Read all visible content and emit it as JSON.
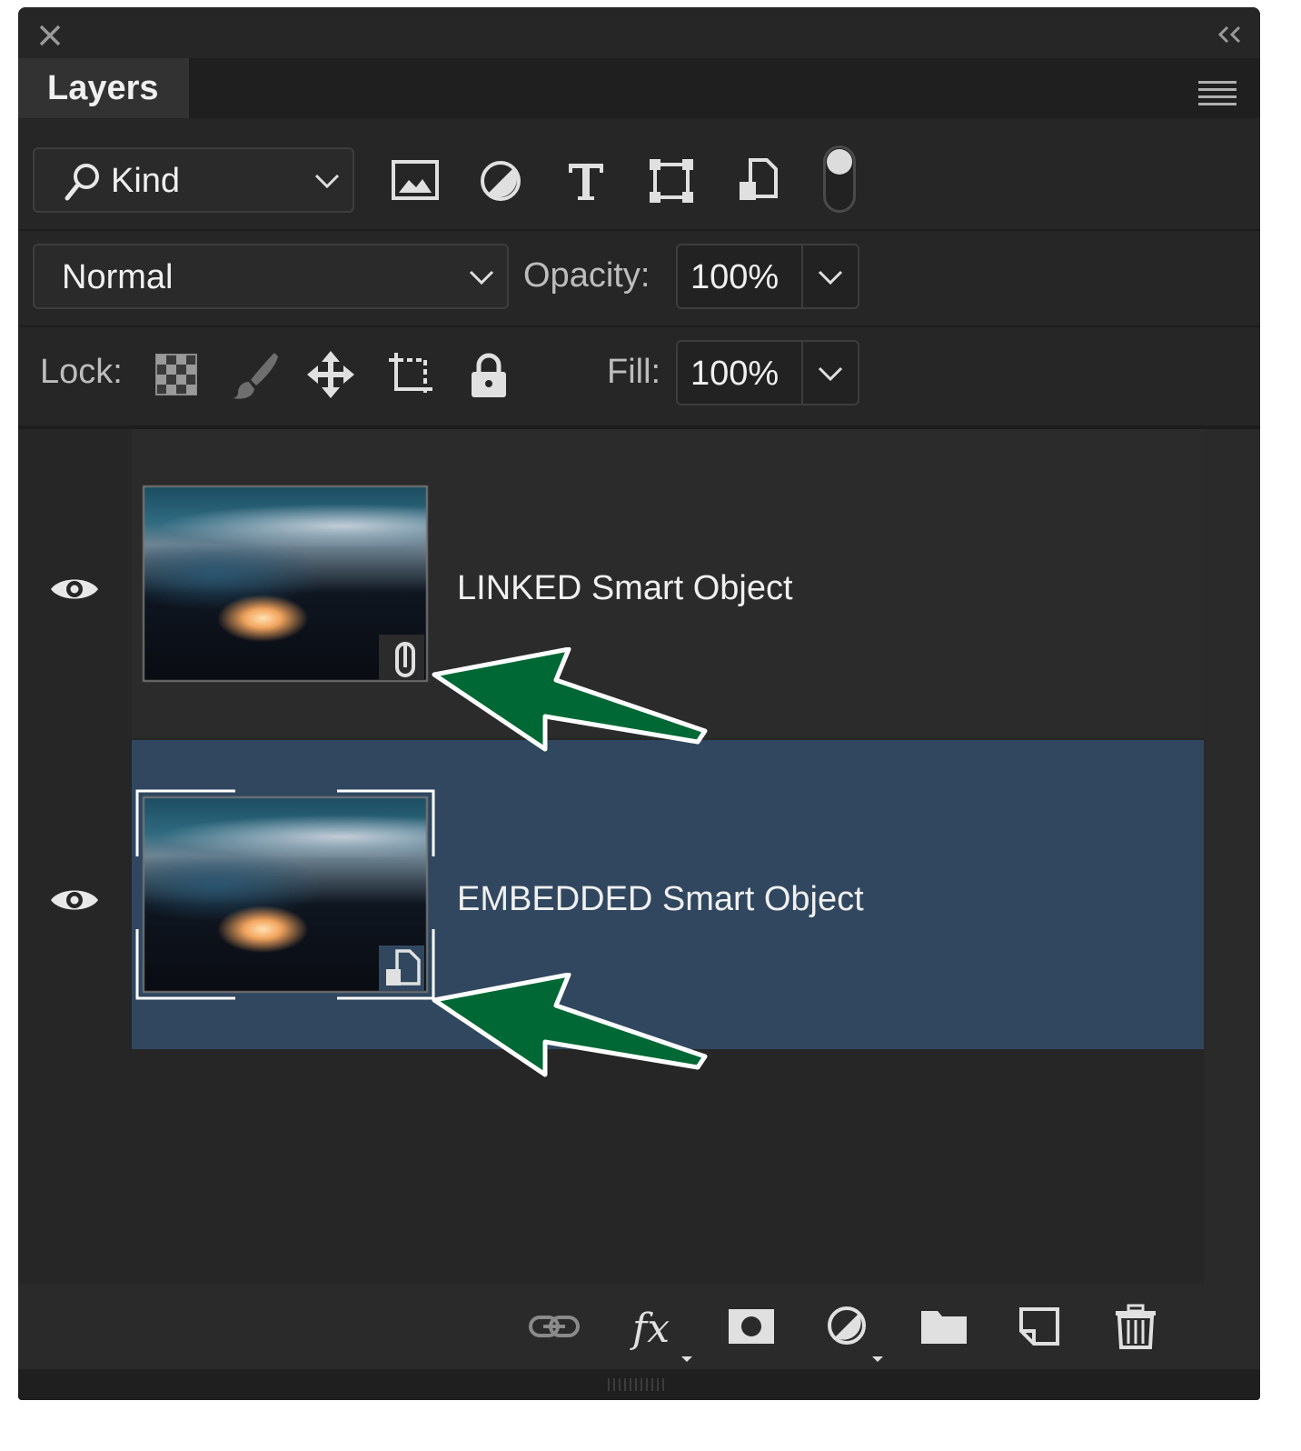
{
  "panel": {
    "tab_label": "Layers"
  },
  "filter": {
    "kind_label": "Kind",
    "icons": [
      "image-filter-icon",
      "adjustment-filter-icon",
      "type-filter-icon",
      "shape-filter-icon",
      "smart-object-filter-icon"
    ]
  },
  "blend": {
    "mode": "Normal",
    "opacity_label": "Opacity:",
    "opacity_value": "100%"
  },
  "lock": {
    "label": "Lock:",
    "fill_label": "Fill:",
    "fill_value": "100%"
  },
  "layers": [
    {
      "name": "LINKED Smart Object",
      "type": "linked",
      "visible": true,
      "selected": false
    },
    {
      "name": "EMBEDDED Smart Object",
      "type": "embedded",
      "visible": true,
      "selected": true
    }
  ],
  "colors": {
    "panel_bg": "#262626",
    "selected_row": "#30475f",
    "annotation_arrow": "#006835"
  }
}
